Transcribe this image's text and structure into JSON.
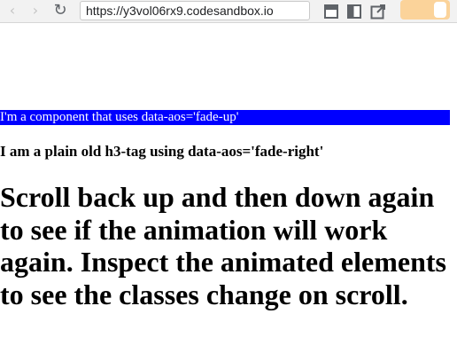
{
  "browser": {
    "url": "https://y3vol06rx9.codesandbox.io",
    "back_icon": "chevron-left-icon",
    "forward_icon": "chevron-right-icon",
    "reload_icon": "reload-icon",
    "toolbar_icons": [
      "minimize-window-icon",
      "split-view-icon",
      "open-new-window-icon"
    ],
    "profile_color": "#fbd39a"
  },
  "page": {
    "fade_up_text": "I'm a component that uses data-aos='fade-up'",
    "fade_up_bg": "#0000ff",
    "h3_text": "I am a plain old h3-tag using data-aos='fade-right'",
    "big_text_lines": [
      "Scroll back up and then down again",
      "to see if the animation will work",
      "again. Inspect the animated elements",
      "to see the classes change on scroll."
    ]
  }
}
